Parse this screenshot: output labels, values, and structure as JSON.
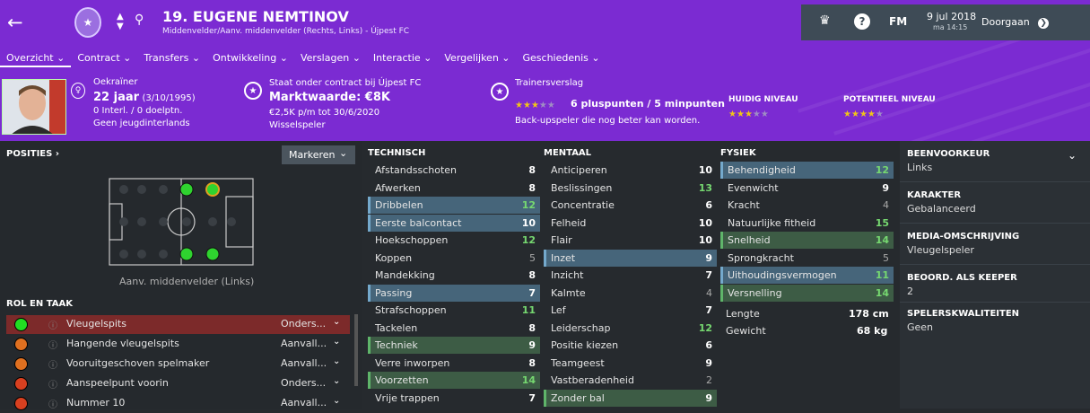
{
  "header": {
    "player_name": "19. EUGENE NEMTINOV",
    "player_sub": "Middenvelder/Aanv. middenvelder (Rechts, Links) - Újpest FC",
    "date": "9 jul 2018",
    "time": "ma 14:15",
    "continue_label": "Doorgaan",
    "fm_label": "FM",
    "help_label": "?"
  },
  "nav": {
    "tabs": [
      "Overzicht",
      "Contract",
      "Transfers",
      "Ontwikkeling",
      "Verslagen",
      "Interactie",
      "Vergelijken",
      "Geschiedenis"
    ]
  },
  "profile": {
    "nationality": "Oekraïner",
    "age": "22 jaar",
    "birth": "(3/10/1995)",
    "caps": "0 Interl. / 0 doelptn.",
    "youth": "Geen jeugdinterlands",
    "contract_line": "Staat onder contract bij Újpest FC",
    "market_value": "Marktwaarde: €8K",
    "wage": "€2,5K p/m tot 30/6/2020",
    "status": "Wisselspeler",
    "scout_title": "Trainersverslag",
    "scout_points": "6 pluspunten / 5 minpunten",
    "scout_summary": "Back-upspeler die nog beter kan worden.",
    "coach_stars": 3,
    "current_label": "HUIDIG NIVEAU",
    "current_stars": 3,
    "potential_label": "POTENTIEEL NIVEAU",
    "potential_stars": 4
  },
  "positions": {
    "title": "POSITIES",
    "marker_label": "Markeren",
    "caption": "Aanv. middenvelder (Links)"
  },
  "roles": {
    "title": "ROL EN TAAK",
    "items": [
      {
        "name": "Vleugelspits",
        "duty": "Onders...",
        "color": "#22dd22"
      },
      {
        "name": "Hangende vleugelspits",
        "duty": "Aanvall...",
        "color": "#e07020"
      },
      {
        "name": "Vooruitgeschoven spelmaker",
        "duty": "Aanvall...",
        "color": "#e07020"
      },
      {
        "name": "Aanspeelpunt voorin",
        "duty": "Onders...",
        "color": "#d84020"
      },
      {
        "name": "Nummer 10",
        "duty": "Aanvall...",
        "color": "#d84020"
      }
    ]
  },
  "technisch": {
    "title": "TECHNISCH",
    "items": [
      {
        "name": "Afstandsschoten",
        "value": "8",
        "hl": ""
      },
      {
        "name": "Afwerken",
        "value": "8",
        "hl": ""
      },
      {
        "name": "Dribbelen",
        "value": "12",
        "hl": "blue"
      },
      {
        "name": "Eerste balcontact",
        "value": "10",
        "hl": "blue"
      },
      {
        "name": "Hoekschoppen",
        "value": "12",
        "hl": ""
      },
      {
        "name": "Koppen",
        "value": "5",
        "hl": ""
      },
      {
        "name": "Mandekking",
        "value": "8",
        "hl": ""
      },
      {
        "name": "Passing",
        "value": "7",
        "hl": "blue"
      },
      {
        "name": "Strafschoppen",
        "value": "11",
        "hl": ""
      },
      {
        "name": "Tackelen",
        "value": "8",
        "hl": ""
      },
      {
        "name": "Techniek",
        "value": "9",
        "hl": "green"
      },
      {
        "name": "Verre inworpen",
        "value": "8",
        "hl": ""
      },
      {
        "name": "Voorzetten",
        "value": "14",
        "hl": "green"
      },
      {
        "name": "Vrije trappen",
        "value": "7",
        "hl": ""
      }
    ]
  },
  "mentaal": {
    "title": "MENTAAL",
    "items": [
      {
        "name": "Anticiperen",
        "value": "10",
        "hl": ""
      },
      {
        "name": "Beslissingen",
        "value": "13",
        "hl": ""
      },
      {
        "name": "Concentratie",
        "value": "6",
        "hl": ""
      },
      {
        "name": "Felheid",
        "value": "10",
        "hl": ""
      },
      {
        "name": "Flair",
        "value": "10",
        "hl": ""
      },
      {
        "name": "Inzet",
        "value": "9",
        "hl": "blue"
      },
      {
        "name": "Inzicht",
        "value": "7",
        "hl": ""
      },
      {
        "name": "Kalmte",
        "value": "4",
        "hl": ""
      },
      {
        "name": "Lef",
        "value": "7",
        "hl": ""
      },
      {
        "name": "Leiderschap",
        "value": "12",
        "hl": ""
      },
      {
        "name": "Positie kiezen",
        "value": "6",
        "hl": ""
      },
      {
        "name": "Teamgeest",
        "value": "9",
        "hl": ""
      },
      {
        "name": "Vastberadenheid",
        "value": "2",
        "hl": ""
      },
      {
        "name": "Zonder bal",
        "value": "9",
        "hl": "green"
      }
    ]
  },
  "fysiek": {
    "title": "FYSIEK",
    "items": [
      {
        "name": "Behendigheid",
        "value": "12",
        "hl": "blue"
      },
      {
        "name": "Evenwicht",
        "value": "9",
        "hl": ""
      },
      {
        "name": "Kracht",
        "value": "4",
        "hl": ""
      },
      {
        "name": "Natuurlijke fitheid",
        "value": "15",
        "hl": ""
      },
      {
        "name": "Snelheid",
        "value": "14",
        "hl": "green"
      },
      {
        "name": "Sprongkracht",
        "value": "5",
        "hl": ""
      },
      {
        "name": "Uithoudingsvermogen",
        "value": "11",
        "hl": "blue"
      },
      {
        "name": "Versnelling",
        "value": "14",
        "hl": "green"
      }
    ],
    "length_label": "Lengte",
    "length_value": "178 cm",
    "weight_label": "Gewicht",
    "weight_value": "68 kg"
  },
  "details": {
    "foot_title": "BEENVOORKEUR",
    "foot_value": "Links",
    "char_title": "KARAKTER",
    "char_value": "Gebalanceerd",
    "media_title": "MEDIA-OMSCHRIJVING",
    "media_value": "Vleugelspeler",
    "keeper_title": "BEOORD. ALS KEEPER",
    "keeper_value": "2",
    "skills_title": "SPELERSKWALITEITEN",
    "skills_value": "Geen"
  }
}
